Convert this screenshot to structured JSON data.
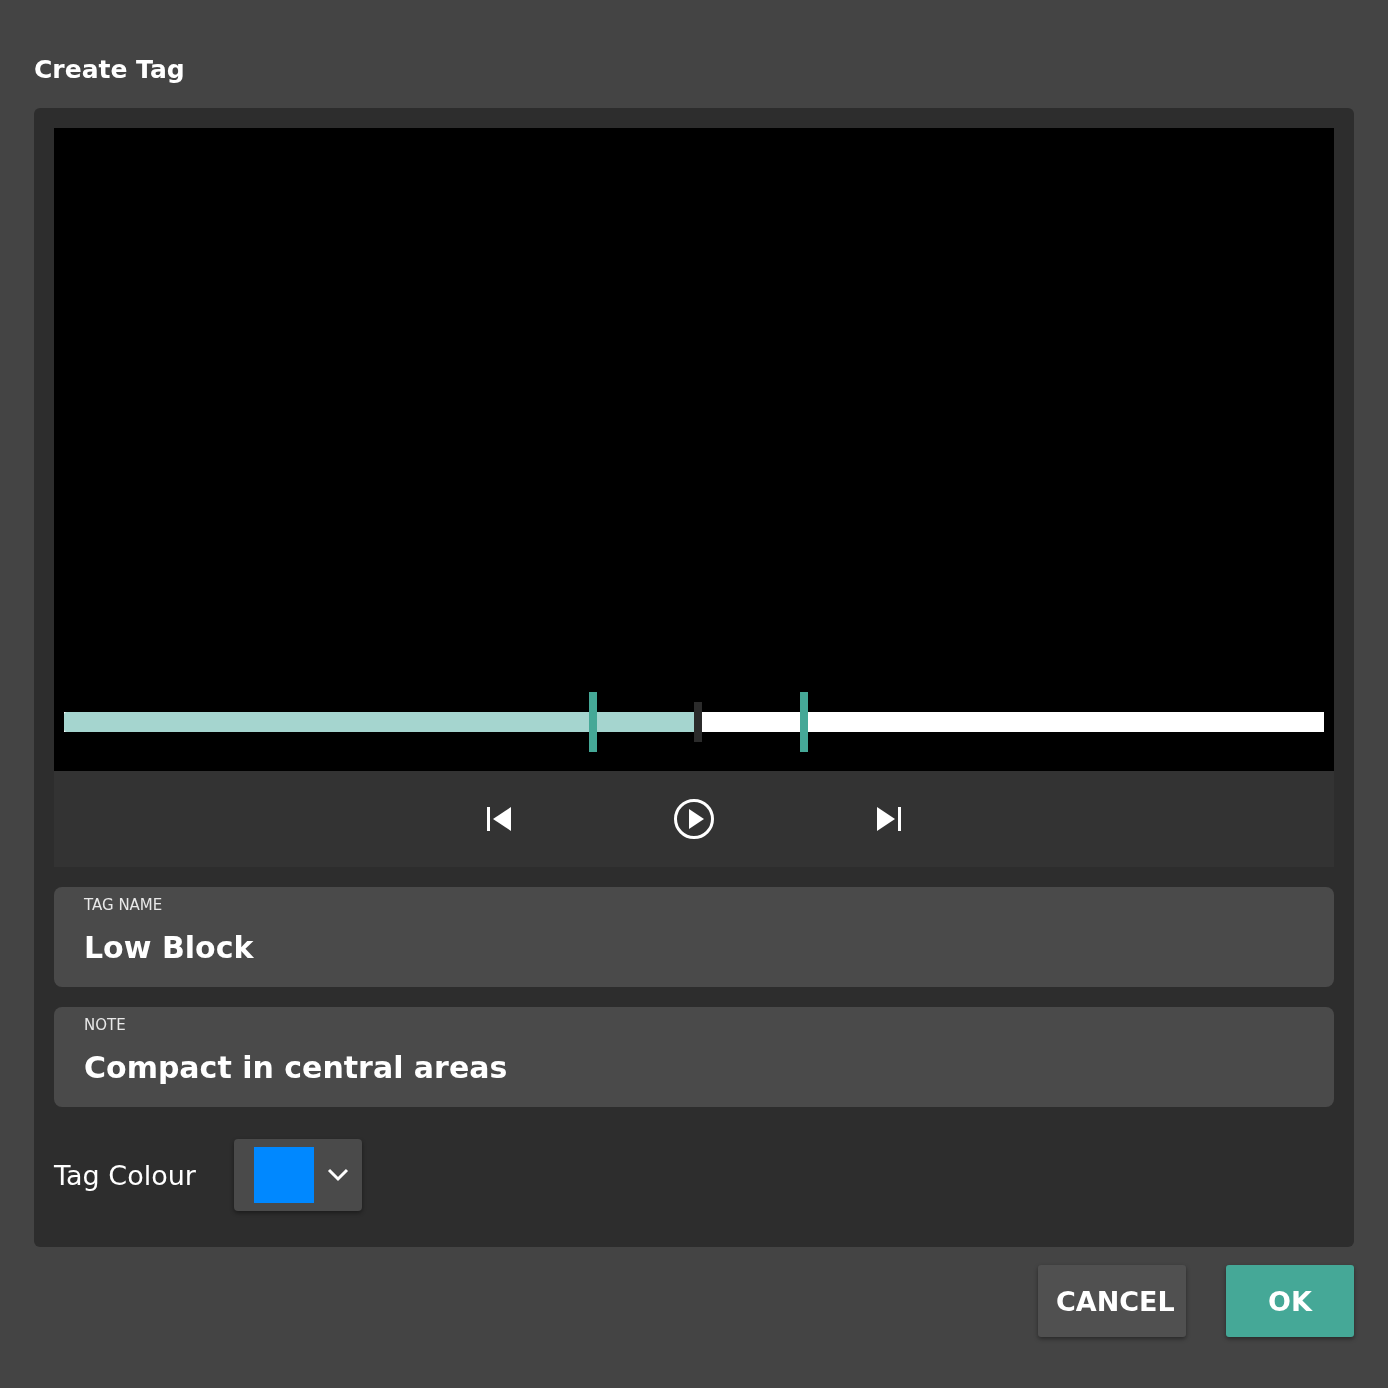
{
  "dialog": {
    "title": "Create Tag"
  },
  "player": {
    "progress": {
      "level": 0.503
    },
    "markers": [
      {
        "level": 0.42
      },
      {
        "level": 0.587
      }
    ]
  },
  "fields": [
    {
      "label": "TAG NAME",
      "value": "Low Block"
    },
    {
      "label": "NOTE",
      "value": "Compact in central areas"
    }
  ],
  "colour_picker": {
    "label": "Tag Colour",
    "color": "#0088ff"
  },
  "buttons": [
    {
      "label": "CANCEL",
      "kind": "secondary"
    },
    {
      "label": "OK",
      "kind": "primary"
    }
  ]
}
